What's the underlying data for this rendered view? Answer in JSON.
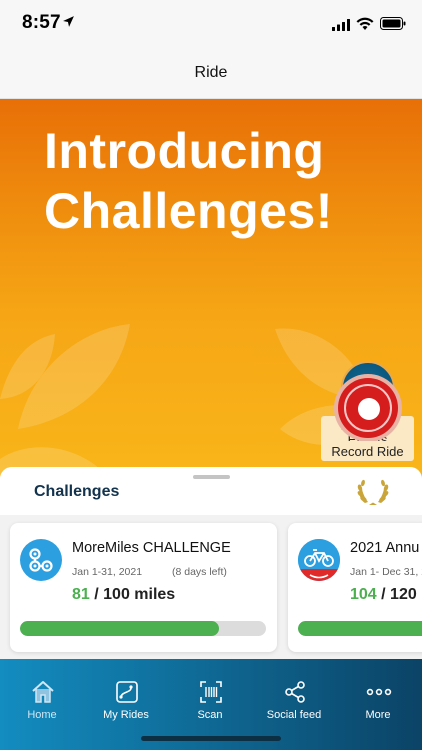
{
  "status_bar": {
    "time": "8:57"
  },
  "header": {
    "title": "Ride"
  },
  "hero": {
    "title_line1": "Introducing",
    "title_line2": "Challenges!",
    "routes_label_line1": "Routes &",
    "routes_label_line2": "Events",
    "record_label": "Record Ride"
  },
  "challenges": {
    "title": "Challenges",
    "cards": [
      {
        "title": "MoreMiles CHALLENGE",
        "dates": "Jan 1-31, 2021",
        "days_left": "(8 days left)",
        "progress": "81",
        "goal": "/ 100 miles",
        "fraction": 0.81
      },
      {
        "title": "2021 Annu",
        "dates": "Jan 1- Dec 31, 2",
        "progress": "104",
        "goal": "/ 120",
        "fraction": 0.87
      }
    ]
  },
  "tabs": [
    {
      "label": "Home",
      "icon": "home-icon",
      "active": true
    },
    {
      "label": "My Rides",
      "icon": "my-rides-icon"
    },
    {
      "label": "Scan",
      "icon": "scan-icon"
    },
    {
      "label": "Social feed",
      "icon": "share-icon"
    },
    {
      "label": "More",
      "icon": "more-dots-icon"
    }
  ],
  "colors": {
    "accent_orange": "#ef8d0e",
    "nav_blue": "#0f6c98",
    "progress_green": "#4caf50",
    "record_red": "#d61d1d"
  }
}
